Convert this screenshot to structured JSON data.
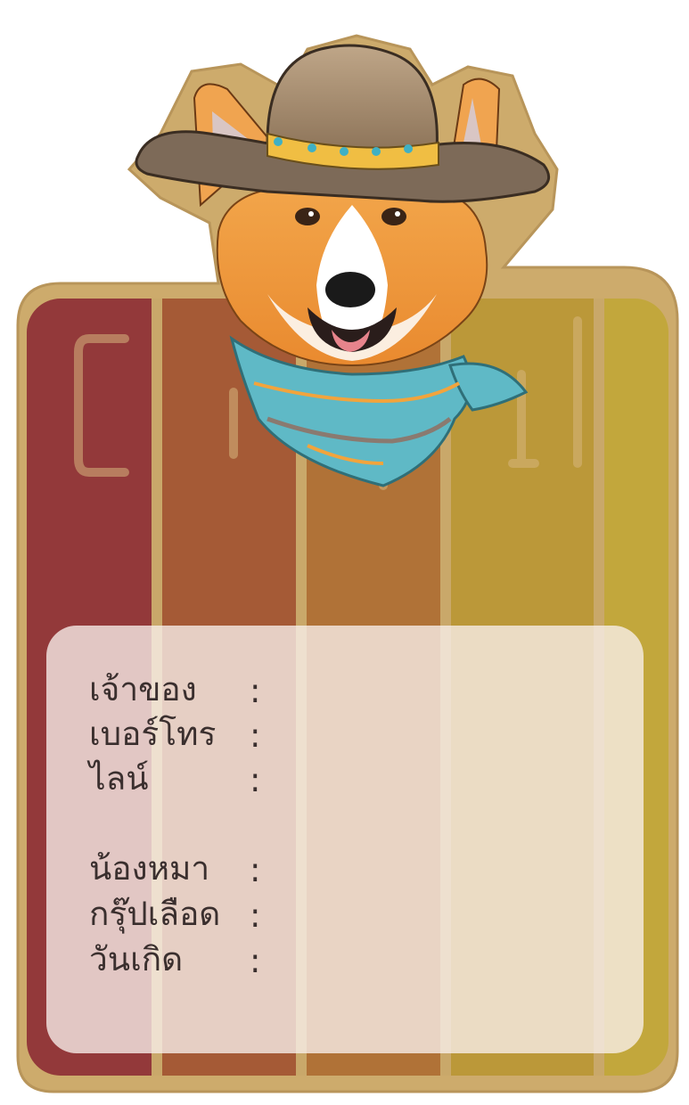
{
  "background": {
    "stripe_colors": [
      "#93393a",
      "#a55a36",
      "#b07237",
      "#bb9839",
      "#c2a73c"
    ],
    "board_color": "#c9a86a",
    "big_letters": [
      "C",
      "O",
      "R",
      "G",
      "I"
    ]
  },
  "illustration": {
    "subject": "corgi-with-cowboy-hat-and-bandana"
  },
  "form": {
    "owner_label": "เจ้าของ",
    "phone_label": "เบอร์โทร",
    "line_label": "ไลน์",
    "pet_name_label": "น้องหมา",
    "blood_group_label": "กรุ๊ปเลือด",
    "birthday_label": "วันเกิด",
    "separator": ":"
  }
}
